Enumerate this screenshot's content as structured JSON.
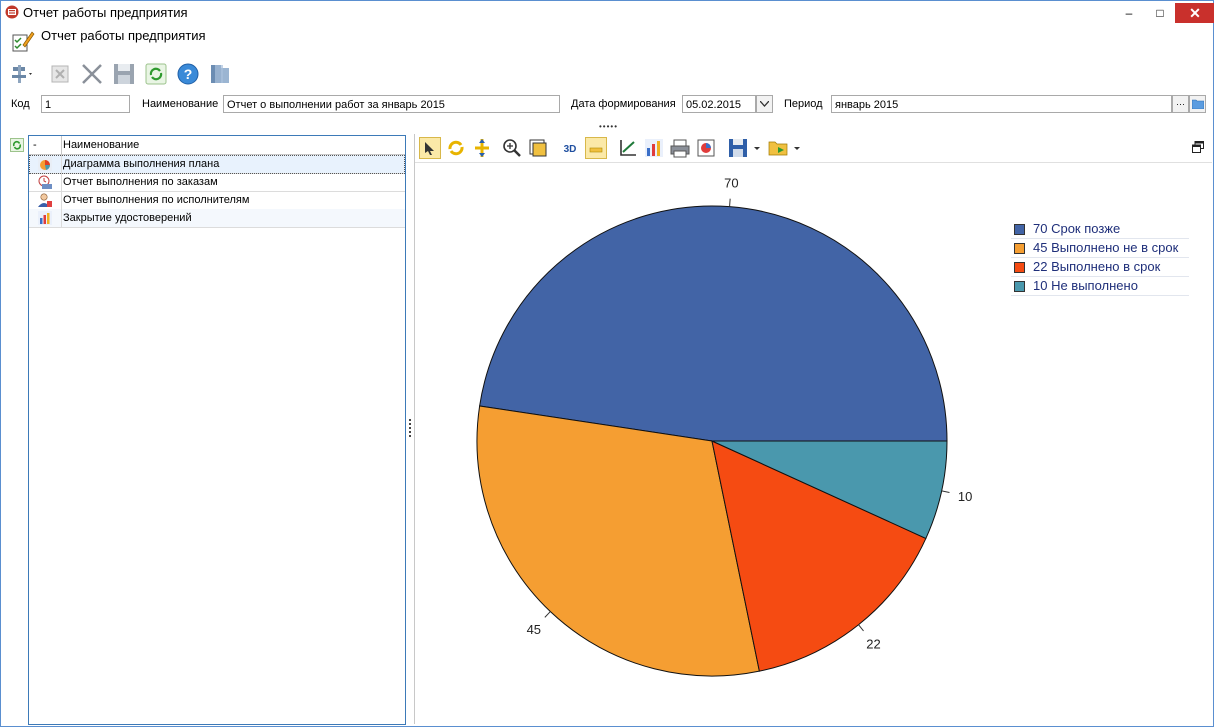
{
  "window": {
    "title": "Отчет работы предприятия",
    "min_glyph": "–",
    "max_glyph": "□",
    "close_glyph": "✕"
  },
  "doc": {
    "title": "Отчет работы предприятия"
  },
  "toolbar": {
    "icons": [
      "settings-icon",
      "delete-disabled-icon",
      "close-icon",
      "save-icon",
      "refresh-icon",
      "help-icon",
      "exit-icon"
    ]
  },
  "fields": {
    "code_label": "Код",
    "code_value": "1",
    "name_label": "Наименование",
    "name_value": "Отчет о выполнении работ за январь 2015",
    "date_label": "Дата формирования",
    "date_value": "05.02.2015",
    "period_label": "Период",
    "period_value": "январь 2015",
    "period_dots": "···"
  },
  "splitter": {
    "h_dots": "•••••"
  },
  "tree": {
    "header_col1": "-",
    "header_col2": "Наименование",
    "rows": [
      {
        "label": "Диаграмма выполнения плана",
        "icon": "pie-chart-icon"
      },
      {
        "label": "Отчет выполнения по заказам",
        "icon": "orders-report-icon"
      },
      {
        "label": "Отчет выполнения по исполнителям",
        "icon": "user-report-icon"
      },
      {
        "label": "Закрытие удостоверений",
        "icon": "bar-chart-icon"
      }
    ]
  },
  "chart_toolbar": {
    "three_d_label": "3D"
  },
  "colors": {
    "slice_1": "#4264a6",
    "slice_2": "#f59e32",
    "slice_3": "#f54b12",
    "slice_4": "#4a98ad",
    "accent": "#2f6fc0"
  },
  "chart_data": {
    "type": "pie",
    "categories": [
      "Срок позже",
      "Выполнено не в срок",
      "Выполнено в срок",
      "Не выполнено"
    ],
    "values": [
      70,
      45,
      22,
      10
    ],
    "value_labels": [
      "70",
      "45",
      "22",
      "10"
    ],
    "legend": [
      "70 Срок позже",
      "45 Выполнено не в срок",
      "22 Выполнено в срок",
      "10 Не выполнено"
    ],
    "legend_position": "top-right",
    "start_angle_deg": 0,
    "direction": "counterclockwise"
  }
}
